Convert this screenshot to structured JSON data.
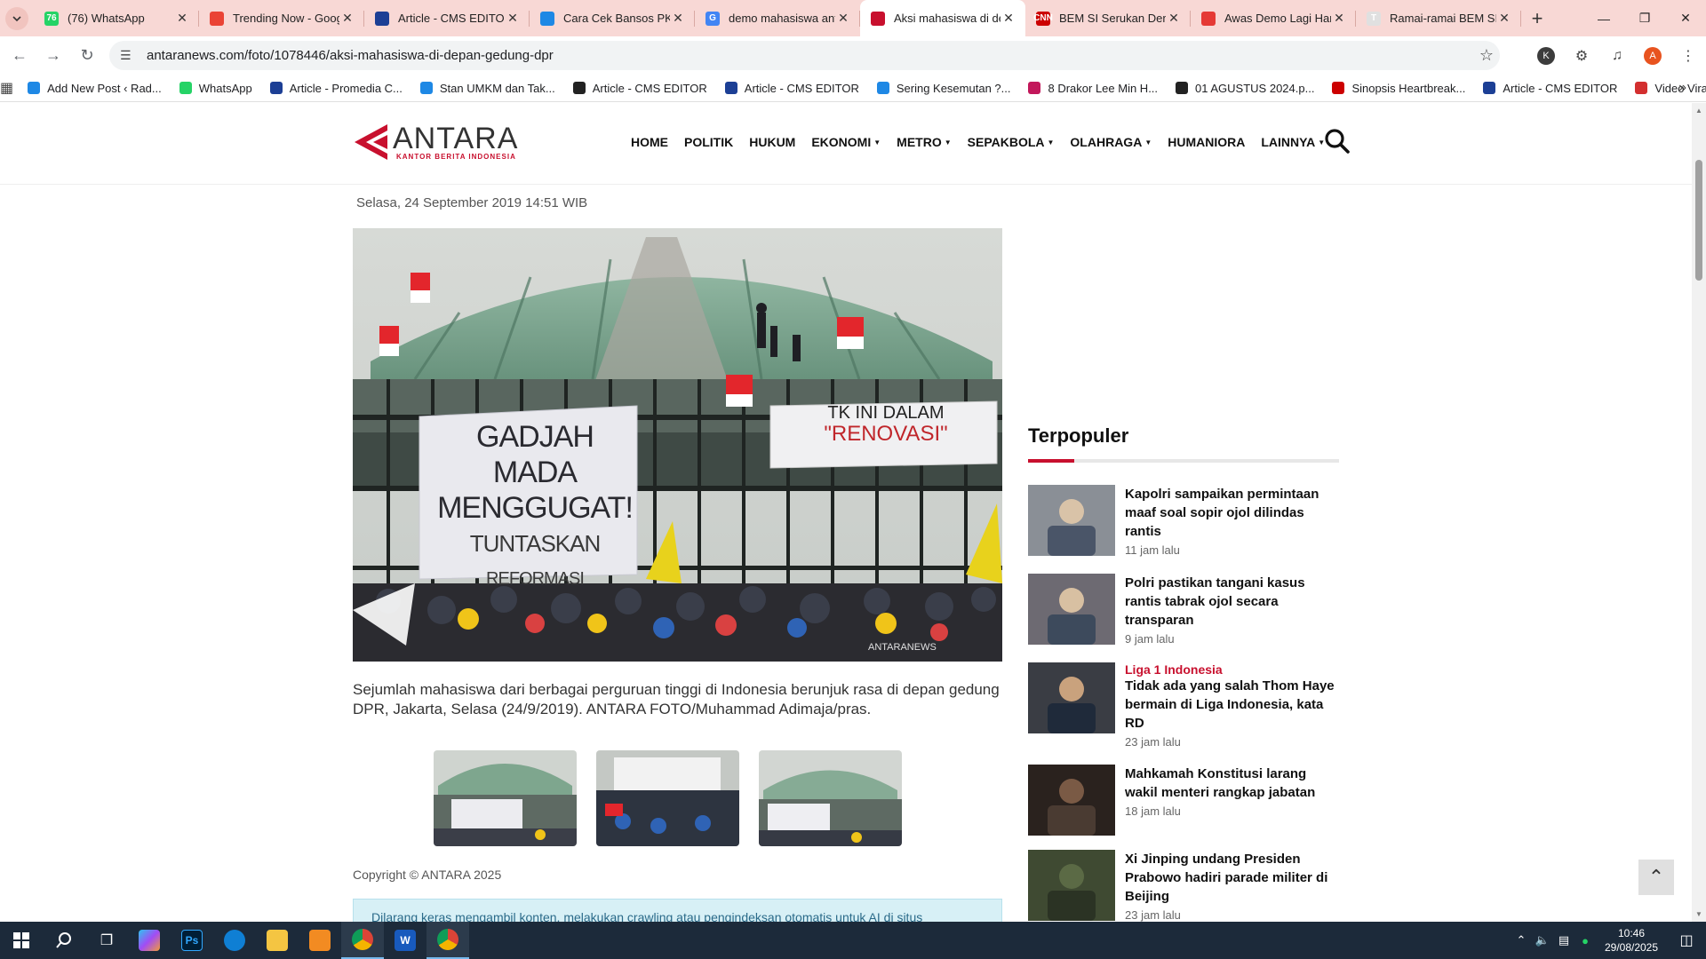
{
  "browser": {
    "tabs": [
      {
        "title": "(76) WhatsApp",
        "favicon_color": "#25D366",
        "favicon_text": "76"
      },
      {
        "title": "Trending Now - Google Trends",
        "favicon_color": "#ea4335",
        "favicon_text": ""
      },
      {
        "title": "Article - CMS EDITOR",
        "favicon_color": "#1c3f95",
        "favicon_text": ""
      },
      {
        "title": "Cara Cek Bansos PKH",
        "favicon_color": "#1e88e5",
        "favicon_text": ""
      },
      {
        "title": "demo mahasiswa antara",
        "favicon_color": "#4285f4",
        "favicon_text": "G"
      },
      {
        "title": "Aksi mahasiswa di depan",
        "favicon_color": "#c8102e",
        "favicon_text": ""
      },
      {
        "title": "BEM SI Serukan Demo",
        "favicon_color": "#cc0000",
        "favicon_text": "CNN"
      },
      {
        "title": "Awas Demo Lagi Hari",
        "favicon_color": "#e53935",
        "favicon_text": ""
      },
      {
        "title": "Ramai-ramai BEM SI",
        "favicon_color": "#e0e0e0",
        "favicon_text": "T"
      }
    ],
    "active_tab_index": 5,
    "url": "antaranews.com/foto/1078446/aksi-mahasiswa-di-depan-gedung-dpr",
    "bookmarks": [
      {
        "label": "Add New Post ‹ Rad...",
        "color": "#1e88e5"
      },
      {
        "label": "WhatsApp",
        "color": "#25D366"
      },
      {
        "label": "Article - Promedia C...",
        "color": "#1c3f95"
      },
      {
        "label": "Stan UMKM dan Tak...",
        "color": "#1e88e5"
      },
      {
        "label": "Article - CMS EDITOR",
        "color": "#222222"
      },
      {
        "label": "Article - CMS EDITOR",
        "color": "#1c3f95"
      },
      {
        "label": "Sering Kesemutan ?...",
        "color": "#1e88e5"
      },
      {
        "label": "8 Drakor Lee Min H...",
        "color": "#c2185b"
      },
      {
        "label": "01 AGUSTUS 2024.p...",
        "color": "#222222"
      },
      {
        "label": "Sinopsis Heartbreak...",
        "color": "#cc0000"
      },
      {
        "label": "Article - CMS EDITOR",
        "color": "#1c3f95"
      },
      {
        "label": "Video Viral Erin Bug...",
        "color": "#d32f2f"
      }
    ]
  },
  "site": {
    "logo_word": "ANTARA",
    "logo_tagline": "KANTOR BERITA INDONESIA",
    "brand_color": "#c8102e",
    "nav": [
      {
        "label": "HOME",
        "dropdown": false
      },
      {
        "label": "POLITIK",
        "dropdown": false
      },
      {
        "label": "HUKUM",
        "dropdown": false
      },
      {
        "label": "EKONOMI",
        "dropdown": true
      },
      {
        "label": "METRO",
        "dropdown": true
      },
      {
        "label": "SEPAKBOLA",
        "dropdown": true
      },
      {
        "label": "OLAHRAGA",
        "dropdown": true
      },
      {
        "label": "HUMANIORA",
        "dropdown": false
      },
      {
        "label": "LAINNYA",
        "dropdown": true
      }
    ]
  },
  "article": {
    "dateline": "Selasa, 24 September 2019 14:51 WIB",
    "banner_left": [
      "GADJAH",
      "MADA",
      "MENGGUGAT!",
      "TUNTASKAN",
      "REFORMASI"
    ],
    "banner_right": [
      "TK INI DALAM",
      "\"RENOVASI\""
    ],
    "watermark": "ANTARANEWS",
    "caption": "Sejumlah mahasiswa dari berbagai perguruan tinggi di Indonesia berunjuk rasa di depan gedung DPR, Jakarta, Selasa (24/9/2019). ANTARA FOTO/Muhammad Adimaja/pras.",
    "copyright": "Copyright © ANTARA 2025",
    "notice": "Dilarang keras mengambil konten, melakukan crawling atau pengindeksan otomatis untuk AI di situs"
  },
  "sidebar": {
    "title": "Terpopuler",
    "items": [
      {
        "category": "",
        "headline": "Kapolri sampaikan permintaan maaf soal sopir ojol dilindas rantis",
        "time": "11 jam lalu"
      },
      {
        "category": "",
        "headline": "Polri pastikan tangani kasus rantis tabrak ojol secara transparan",
        "time": "9 jam lalu"
      },
      {
        "category": "Liga 1 Indonesia",
        "headline": "Tidak ada yang salah Thom Haye bermain di Liga Indonesia, kata RD",
        "time": "23 jam lalu"
      },
      {
        "category": "",
        "headline": "Mahkamah Konstitusi larang wakil menteri rangkap jabatan",
        "time": "18 jam lalu"
      },
      {
        "category": "",
        "headline": "Xi Jinping undang Presiden Prabowo hadiri parade militer di Beijing",
        "time": "23 jam lalu"
      }
    ]
  },
  "taskbar": {
    "time": "10:46",
    "date": "29/08/2025"
  }
}
